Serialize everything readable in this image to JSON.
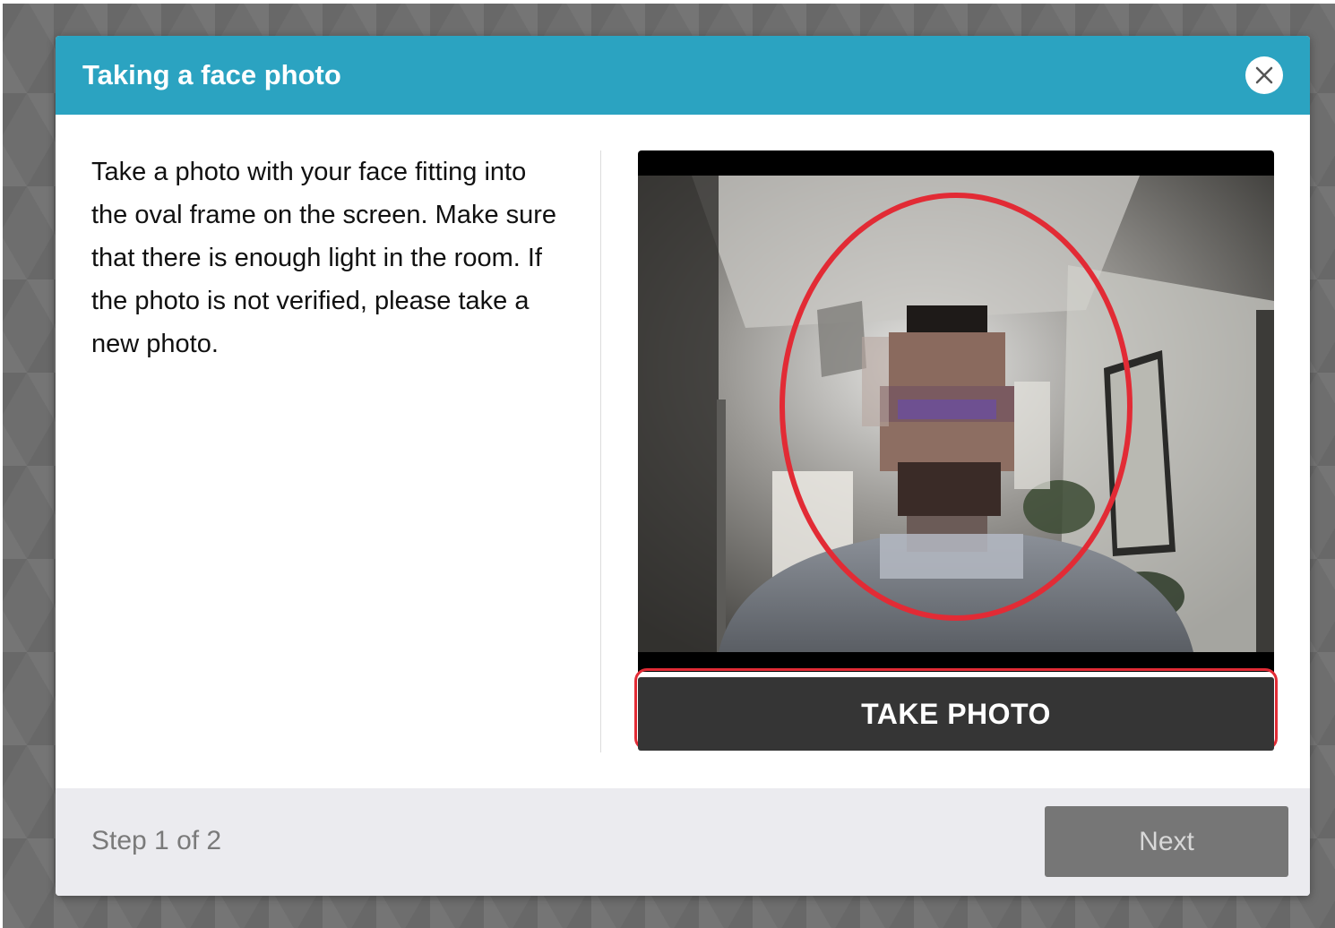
{
  "dialog": {
    "title": "Taking a face photo",
    "close_icon": "close-icon",
    "instructions": "Take a photo with your face fitting into the oval frame on the screen. Make sure that there is enough light in the room. If the photo is not verified, please take a new photo.",
    "take_photo_label": "TAKE PHOTO",
    "step_label": "Step 1 of 2",
    "next_label": "Next"
  },
  "colors": {
    "header": "#2ba3c1",
    "oval": "#e22b35",
    "take_photo_button": "#353535",
    "next_button_disabled": "#767676",
    "footer": "#ebebef"
  }
}
